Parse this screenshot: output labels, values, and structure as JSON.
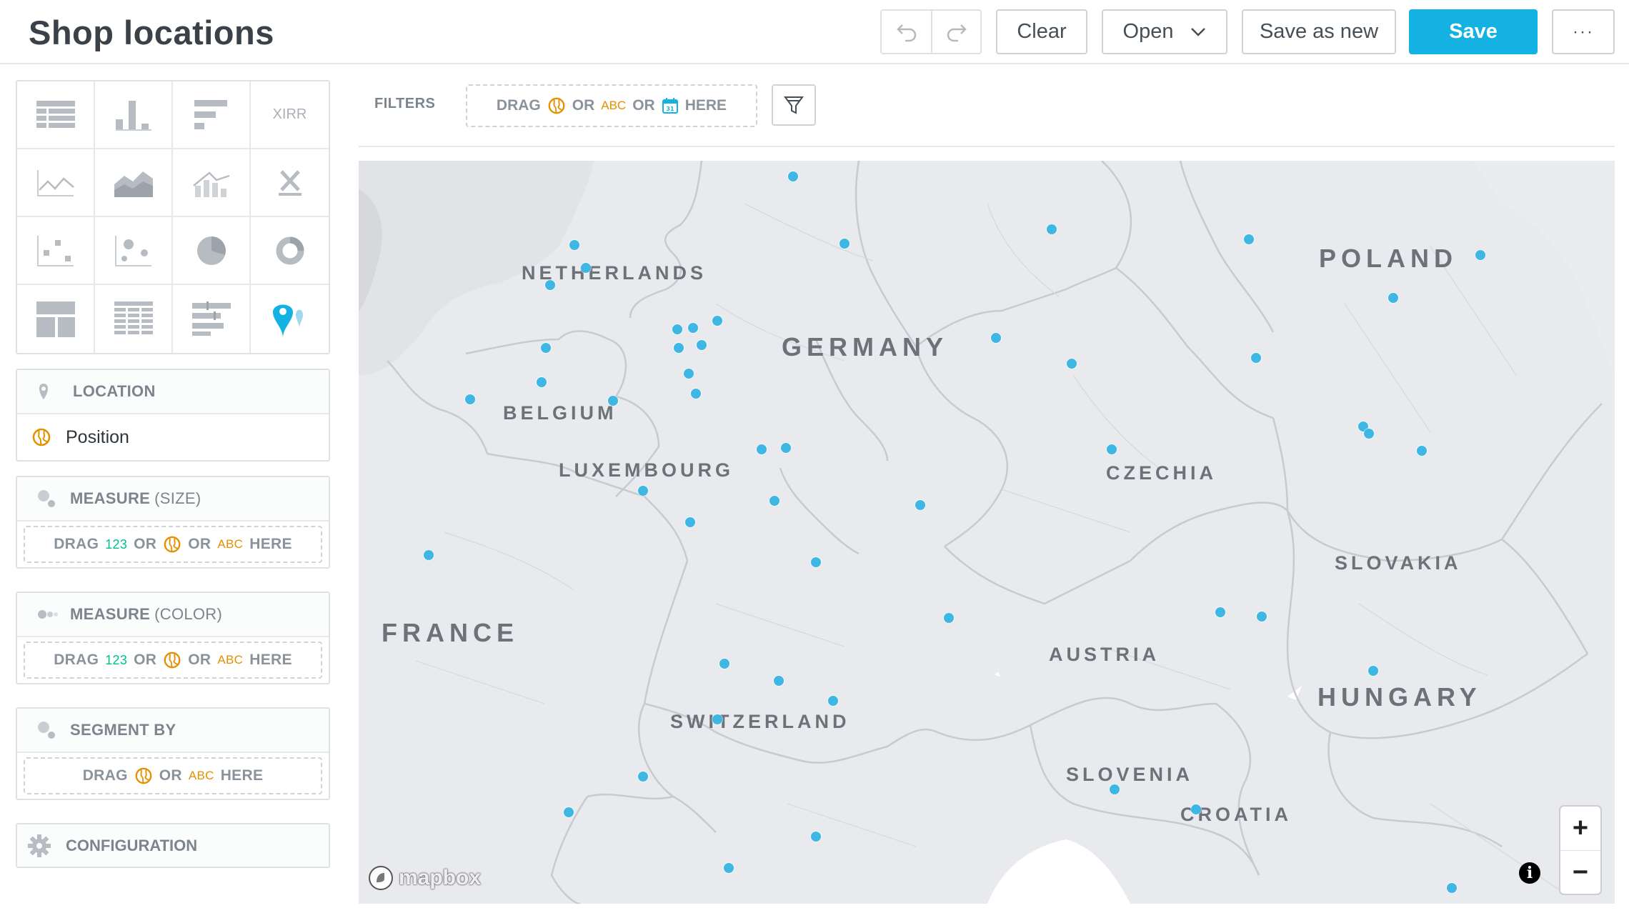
{
  "header": {
    "title": "Shop locations",
    "buttons": {
      "clear": "Clear",
      "open": "Open",
      "save_as_new": "Save as new",
      "save": "Save",
      "more": "···"
    },
    "accent_color": "#14b2e2"
  },
  "visualizations": {
    "items": [
      "table-icon",
      "column-chart-icon",
      "bar-chart-icon",
      "XIRR",
      "line-chart-icon",
      "area-chart-icon",
      "combo-chart-icon",
      "headline-icon",
      "scatter-plot-icon",
      "bubble-chart-icon",
      "pie-chart-icon",
      "donut-chart-icon",
      "treemap-icon",
      "heatmap-icon",
      "bullet-chart-icon",
      "geo-pushpin-icon"
    ],
    "xirr_label": "XIRR",
    "selected": "geo-pushpin-icon"
  },
  "buckets": {
    "location": {
      "title": "LOCATION",
      "item": "Position"
    },
    "measure_size": {
      "title": "MEASURE",
      "sub": "(SIZE)"
    },
    "measure_color": {
      "title": "MEASURE",
      "sub": "(COLOR)"
    },
    "segment_by": {
      "title": "SEGMENT BY"
    },
    "configuration": {
      "title": "CONFIGURATION"
    }
  },
  "dropzone": {
    "drag": "DRAG",
    "or": "OR",
    "num": "123",
    "abc": "ABC",
    "here": "HERE"
  },
  "filters": {
    "label": "FILTERS"
  },
  "map": {
    "pin_color": "#3fb7e4",
    "countries": {
      "netherlands": "NETHERLANDS",
      "germany": "GERMANY",
      "poland": "POLAND",
      "belgium": "BELGIUM",
      "luxembourg": "LUXEMBOURG",
      "czechia": "CZECHIA",
      "slovakia": "SLOVAKIA",
      "france": "FRANCE",
      "austria": "AUSTRIA",
      "hungary": "HUNGARY",
      "switzerland": "SWITZERLAND",
      "slovenia": "SLOVENIA",
      "croatia": "CROATIA"
    },
    "attribution": "mapbox",
    "zoom_in": "+",
    "zoom_out": "−",
    "info": "i"
  }
}
